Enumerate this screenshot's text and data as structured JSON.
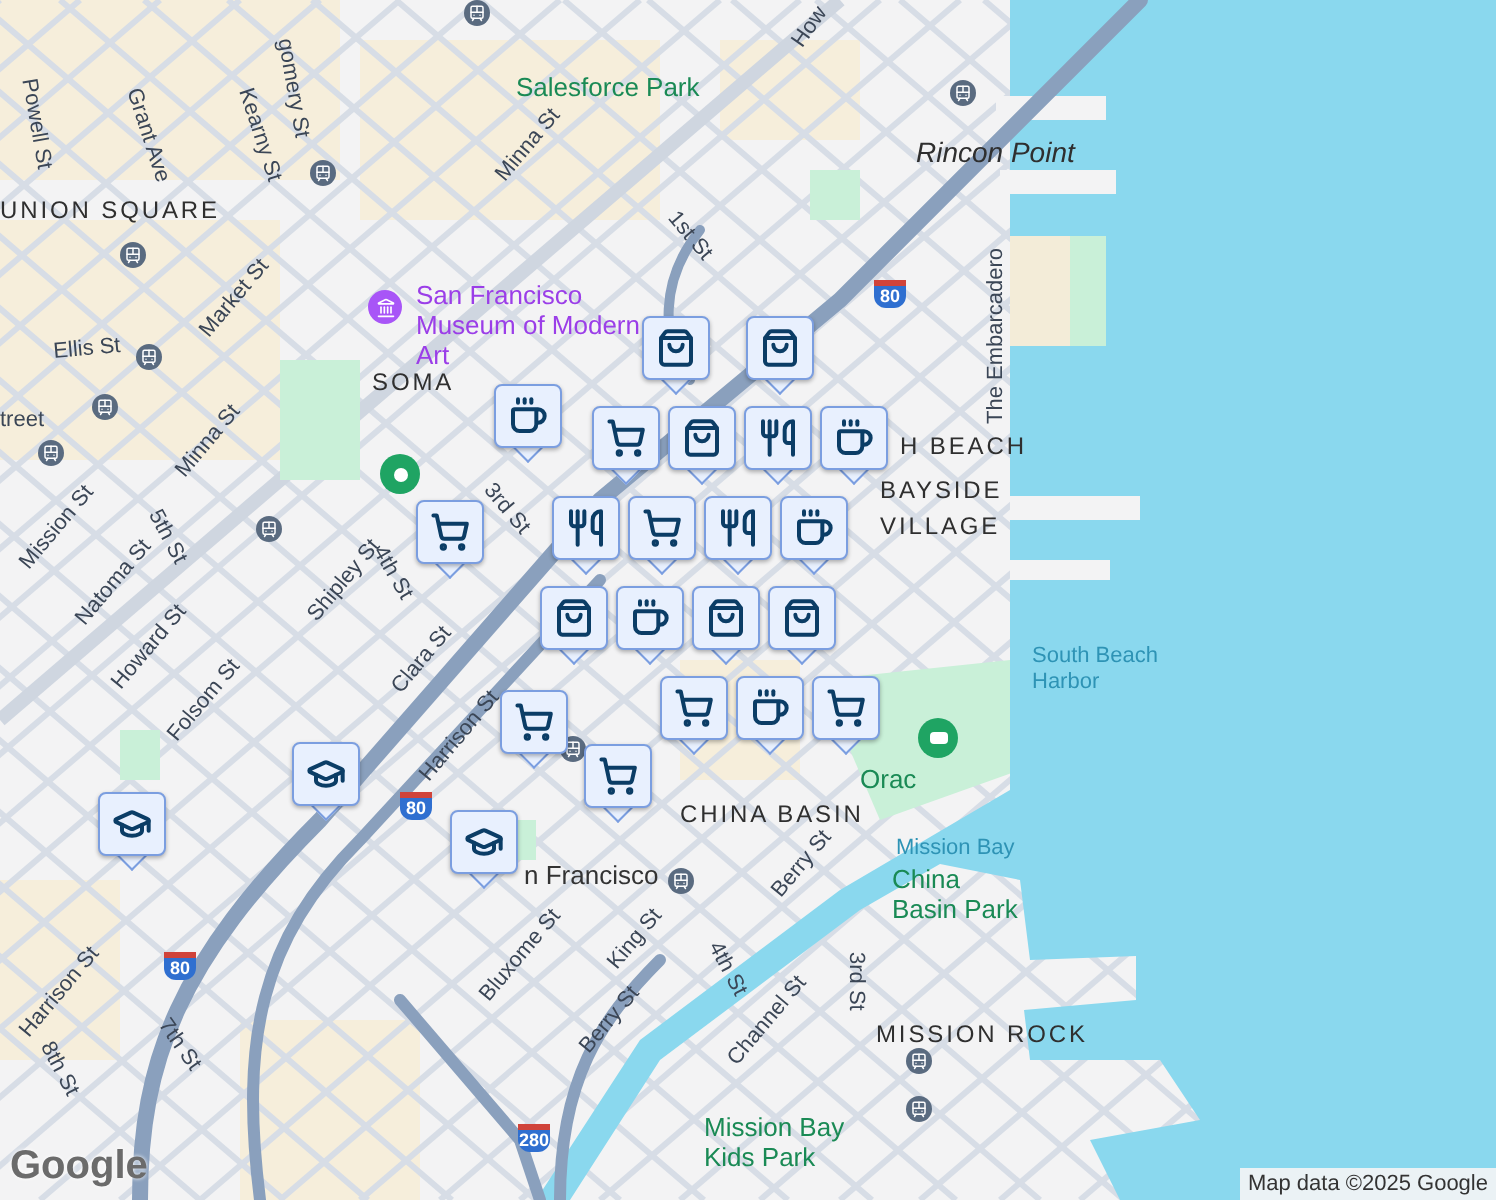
{
  "map": {
    "labels": [
      {
        "text": "Powell St",
        "kind": "street"
      },
      {
        "text": "Grant Ave",
        "kind": "street"
      },
      {
        "text": "Kearny St",
        "kind": "street"
      },
      {
        "text": "gomery St",
        "kind": "street"
      },
      {
        "text": "How",
        "kind": "street"
      },
      {
        "text": "Salesforce Park",
        "kind": "park"
      },
      {
        "text": "Minna St",
        "kind": "street"
      },
      {
        "text": "UNION SQUARE",
        "kind": "district"
      },
      {
        "text": "Market St",
        "kind": "street"
      },
      {
        "text": "1st St",
        "kind": "street"
      },
      {
        "text": "San Francisco Museum of Modern Art",
        "kind": "poi"
      },
      {
        "text": "Ellis St",
        "kind": "street"
      },
      {
        "text": "SOMA",
        "kind": "district"
      },
      {
        "text": "treet",
        "kind": "street"
      },
      {
        "text": "3rd St",
        "kind": "street"
      },
      {
        "text": "Minna St",
        "kind": "street"
      },
      {
        "text": "Mission St",
        "kind": "street"
      },
      {
        "text": "5th St",
        "kind": "street"
      },
      {
        "text": "Natoma St",
        "kind": "street"
      },
      {
        "text": "Howard St",
        "kind": "street"
      },
      {
        "text": "Shipley St",
        "kind": "street"
      },
      {
        "text": "4th St",
        "kind": "street"
      },
      {
        "text": "Clara St",
        "kind": "street"
      },
      {
        "text": "Harrison St",
        "kind": "street"
      },
      {
        "text": "Folsom St",
        "kind": "street"
      },
      {
        "text": "n Francisco",
        "kind": "place"
      },
      {
        "text": "Bluxome St",
        "kind": "street"
      },
      {
        "text": "King St",
        "kind": "street"
      },
      {
        "text": "Berry St",
        "kind": "street"
      },
      {
        "text": "Harrison St",
        "kind": "street"
      },
      {
        "text": "7th St",
        "kind": "street"
      },
      {
        "text": "8th St",
        "kind": "street"
      },
      {
        "text": "Rincon Point",
        "kind": "area"
      },
      {
        "text": "The Embarcadero",
        "kind": "street"
      },
      {
        "text": "H BEACH",
        "kind": "district"
      },
      {
        "text": "BAYSIDE VILLAGE",
        "kind": "district"
      },
      {
        "text": "South Beach Harbor",
        "kind": "water"
      },
      {
        "text": "Orac",
        "kind": "park"
      },
      {
        "text": "CHINA BASIN",
        "kind": "district"
      },
      {
        "text": "Mission Bay",
        "kind": "water"
      },
      {
        "text": "China Basin Park",
        "kind": "park"
      },
      {
        "text": "Berry St",
        "kind": "street"
      },
      {
        "text": "4th St",
        "kind": "street"
      },
      {
        "text": "3rd St",
        "kind": "street"
      },
      {
        "text": "Channel St",
        "kind": "street"
      },
      {
        "text": "MISSION ROCK",
        "kind": "district"
      },
      {
        "text": "Mission Bay Kids Park",
        "kind": "park"
      }
    ],
    "shields": [
      "80",
      "80",
      "80",
      "280"
    ],
    "markers": [
      {
        "kind": "shopping"
      },
      {
        "kind": "shopping"
      },
      {
        "kind": "cafe"
      },
      {
        "kind": "shopping"
      },
      {
        "kind": "cafe"
      },
      {
        "kind": "restaurant"
      },
      {
        "kind": "grocery"
      },
      {
        "kind": "restaurant"
      },
      {
        "kind": "cafe"
      },
      {
        "kind": "restaurant"
      },
      {
        "kind": "grocery"
      },
      {
        "kind": "grocery"
      },
      {
        "kind": "shopping"
      },
      {
        "kind": "shopping"
      },
      {
        "kind": "shopping"
      },
      {
        "kind": "cafe"
      },
      {
        "kind": "grocery"
      },
      {
        "kind": "cafe"
      },
      {
        "kind": "grocery"
      },
      {
        "kind": "grocery"
      },
      {
        "kind": "grocery"
      },
      {
        "kind": "school"
      },
      {
        "kind": "school"
      },
      {
        "kind": "school"
      }
    ],
    "logo": "Google",
    "attribution": "Map data ©2025 Google"
  }
}
